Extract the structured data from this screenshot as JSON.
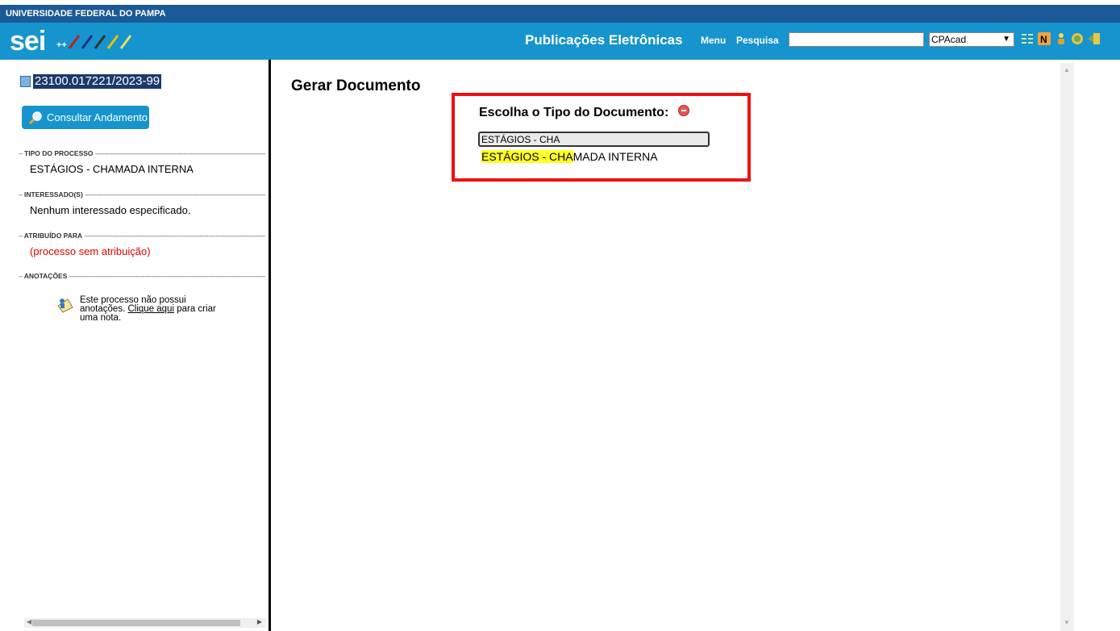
{
  "header": {
    "university": "UNIVERSIDADE FEDERAL DO PAMPA",
    "logo_text": "sei",
    "logo_suffix": "++",
    "app_title": "Publicações Eletrônicas",
    "menu_label": "Menu",
    "search_label": "Pesquisa",
    "search_value": "",
    "unit_selected": "CPAcad",
    "icons": [
      "list-icon",
      "notification-n-icon",
      "user-icon",
      "settings-icon",
      "exit-icon"
    ]
  },
  "sidebar": {
    "process_number": "23100.017221/2023-99",
    "consult_button": "Consultar Andamento",
    "sections": [
      {
        "heading": "TIPO DO PROCESSO",
        "value": "ESTÁGIOS - CHAMADA INTERNA"
      },
      {
        "heading": "INTERESSADO(S)",
        "value": "Nenhum interessado especificado."
      },
      {
        "heading": "ATRIBUÍDO PARA",
        "value": "(processo sem atribuição)"
      },
      {
        "heading": "ANOTAÇÕES",
        "value": ""
      }
    ],
    "note_text_before": "Este processo não possui anotações.",
    "note_link": "Clique aqui",
    "note_text_after": "para criar uma nota."
  },
  "main": {
    "title": "Gerar Documento",
    "choose_label": "Escolha o Tipo do Documento:",
    "type_input_value": "ESTÁGIOS - CHA",
    "suggestion_match": "ESTÁGIOS - CHA",
    "suggestion_rest": "MADA INTERNA"
  },
  "colors": {
    "university_bar": "#1b5a96",
    "header_bar": "#1694cd",
    "highlight_border": "#ee1111",
    "match_highlight": "#ffff22",
    "assignment_red": "#e00000"
  }
}
